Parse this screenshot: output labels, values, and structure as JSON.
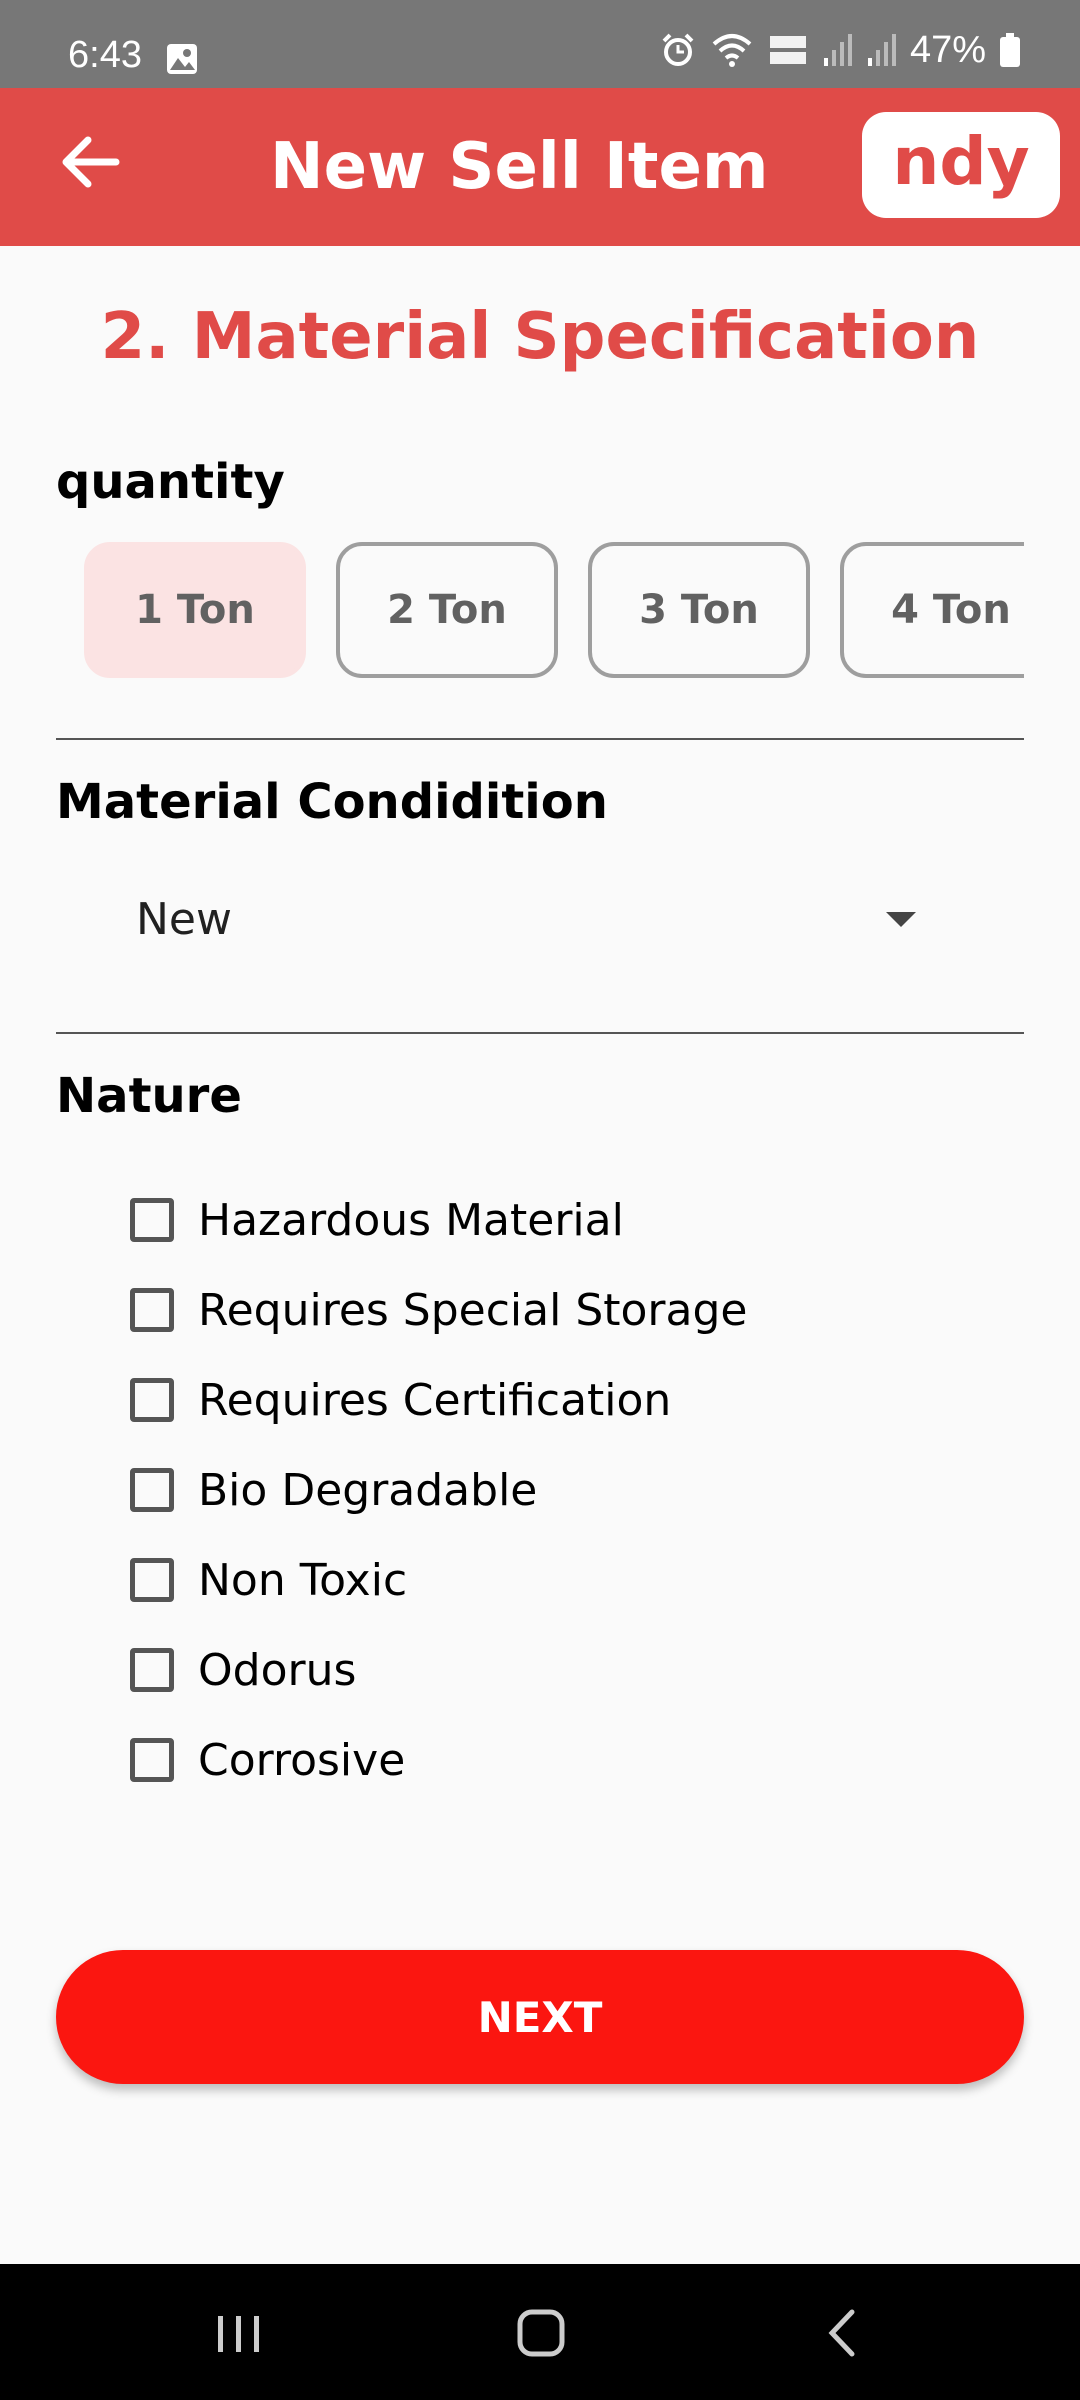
{
  "status_bar": {
    "time": "6:43",
    "battery": "47%",
    "icons": [
      "gallery-icon",
      "alarm-icon",
      "wifi-icon",
      "volte-icon",
      "signal-icon",
      "signal-icon",
      "battery-icon"
    ]
  },
  "app_bar": {
    "title": "New Sell Item",
    "logo_text": "ndy",
    "back_icon": "arrow-left-icon",
    "background": "#e04b48"
  },
  "form": {
    "section_title": "2. Material Specification",
    "quantity_label": "quantity",
    "quantity_options": [
      {
        "label": "1 Ton",
        "selected": true
      },
      {
        "label": "2 Ton",
        "selected": false
      },
      {
        "label": "3 Ton",
        "selected": false
      },
      {
        "label": "4 Ton",
        "selected": false
      }
    ],
    "condition_label": "Material Condidition",
    "condition_value": "New",
    "nature_label": "Nature",
    "nature_options": [
      {
        "label": "Hazardous Material",
        "checked": false
      },
      {
        "label": "Requires Special Storage",
        "checked": false
      },
      {
        "label": "Requires Certification",
        "checked": false
      },
      {
        "label": "Bio Degradable",
        "checked": false
      },
      {
        "label": "Non Toxic",
        "checked": false
      },
      {
        "label": "Odorus",
        "checked": false
      },
      {
        "label": "Corrosive",
        "checked": false
      }
    ],
    "next_label": "NEXT",
    "accent_color": "#e04b48",
    "button_color": "#fb1610"
  },
  "nav_bar": {
    "buttons": [
      "recent-apps-icon",
      "home-icon",
      "back-icon"
    ]
  }
}
